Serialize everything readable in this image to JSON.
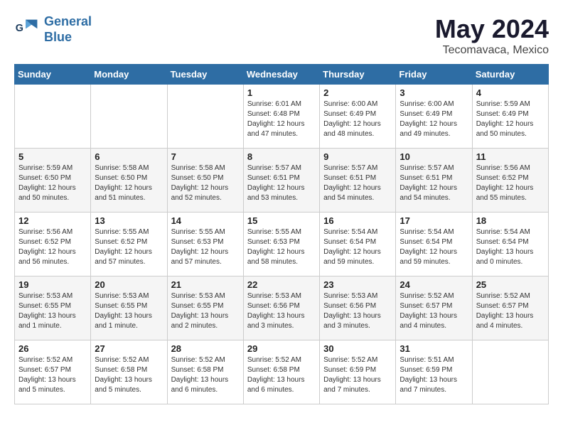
{
  "logo": {
    "line1": "General",
    "line2": "Blue"
  },
  "title": "May 2024",
  "subtitle": "Tecomavaca, Mexico",
  "days_of_week": [
    "Sunday",
    "Monday",
    "Tuesday",
    "Wednesday",
    "Thursday",
    "Friday",
    "Saturday"
  ],
  "weeks": [
    [
      {
        "day": "",
        "info": ""
      },
      {
        "day": "",
        "info": ""
      },
      {
        "day": "",
        "info": ""
      },
      {
        "day": "1",
        "info": "Sunrise: 6:01 AM\nSunset: 6:48 PM\nDaylight: 12 hours\nand 47 minutes."
      },
      {
        "day": "2",
        "info": "Sunrise: 6:00 AM\nSunset: 6:49 PM\nDaylight: 12 hours\nand 48 minutes."
      },
      {
        "day": "3",
        "info": "Sunrise: 6:00 AM\nSunset: 6:49 PM\nDaylight: 12 hours\nand 49 minutes."
      },
      {
        "day": "4",
        "info": "Sunrise: 5:59 AM\nSunset: 6:49 PM\nDaylight: 12 hours\nand 50 minutes."
      }
    ],
    [
      {
        "day": "5",
        "info": "Sunrise: 5:59 AM\nSunset: 6:50 PM\nDaylight: 12 hours\nand 50 minutes."
      },
      {
        "day": "6",
        "info": "Sunrise: 5:58 AM\nSunset: 6:50 PM\nDaylight: 12 hours\nand 51 minutes."
      },
      {
        "day": "7",
        "info": "Sunrise: 5:58 AM\nSunset: 6:50 PM\nDaylight: 12 hours\nand 52 minutes."
      },
      {
        "day": "8",
        "info": "Sunrise: 5:57 AM\nSunset: 6:51 PM\nDaylight: 12 hours\nand 53 minutes."
      },
      {
        "day": "9",
        "info": "Sunrise: 5:57 AM\nSunset: 6:51 PM\nDaylight: 12 hours\nand 54 minutes."
      },
      {
        "day": "10",
        "info": "Sunrise: 5:57 AM\nSunset: 6:51 PM\nDaylight: 12 hours\nand 54 minutes."
      },
      {
        "day": "11",
        "info": "Sunrise: 5:56 AM\nSunset: 6:52 PM\nDaylight: 12 hours\nand 55 minutes."
      }
    ],
    [
      {
        "day": "12",
        "info": "Sunrise: 5:56 AM\nSunset: 6:52 PM\nDaylight: 12 hours\nand 56 minutes."
      },
      {
        "day": "13",
        "info": "Sunrise: 5:55 AM\nSunset: 6:52 PM\nDaylight: 12 hours\nand 57 minutes."
      },
      {
        "day": "14",
        "info": "Sunrise: 5:55 AM\nSunset: 6:53 PM\nDaylight: 12 hours\nand 57 minutes."
      },
      {
        "day": "15",
        "info": "Sunrise: 5:55 AM\nSunset: 6:53 PM\nDaylight: 12 hours\nand 58 minutes."
      },
      {
        "day": "16",
        "info": "Sunrise: 5:54 AM\nSunset: 6:54 PM\nDaylight: 12 hours\nand 59 minutes."
      },
      {
        "day": "17",
        "info": "Sunrise: 5:54 AM\nSunset: 6:54 PM\nDaylight: 12 hours\nand 59 minutes."
      },
      {
        "day": "18",
        "info": "Sunrise: 5:54 AM\nSunset: 6:54 PM\nDaylight: 13 hours\nand 0 minutes."
      }
    ],
    [
      {
        "day": "19",
        "info": "Sunrise: 5:53 AM\nSunset: 6:55 PM\nDaylight: 13 hours\nand 1 minute."
      },
      {
        "day": "20",
        "info": "Sunrise: 5:53 AM\nSunset: 6:55 PM\nDaylight: 13 hours\nand 1 minute."
      },
      {
        "day": "21",
        "info": "Sunrise: 5:53 AM\nSunset: 6:55 PM\nDaylight: 13 hours\nand 2 minutes."
      },
      {
        "day": "22",
        "info": "Sunrise: 5:53 AM\nSunset: 6:56 PM\nDaylight: 13 hours\nand 3 minutes."
      },
      {
        "day": "23",
        "info": "Sunrise: 5:53 AM\nSunset: 6:56 PM\nDaylight: 13 hours\nand 3 minutes."
      },
      {
        "day": "24",
        "info": "Sunrise: 5:52 AM\nSunset: 6:57 PM\nDaylight: 13 hours\nand 4 minutes."
      },
      {
        "day": "25",
        "info": "Sunrise: 5:52 AM\nSunset: 6:57 PM\nDaylight: 13 hours\nand 4 minutes."
      }
    ],
    [
      {
        "day": "26",
        "info": "Sunrise: 5:52 AM\nSunset: 6:57 PM\nDaylight: 13 hours\nand 5 minutes."
      },
      {
        "day": "27",
        "info": "Sunrise: 5:52 AM\nSunset: 6:58 PM\nDaylight: 13 hours\nand 5 minutes."
      },
      {
        "day": "28",
        "info": "Sunrise: 5:52 AM\nSunset: 6:58 PM\nDaylight: 13 hours\nand 6 minutes."
      },
      {
        "day": "29",
        "info": "Sunrise: 5:52 AM\nSunset: 6:58 PM\nDaylight: 13 hours\nand 6 minutes."
      },
      {
        "day": "30",
        "info": "Sunrise: 5:52 AM\nSunset: 6:59 PM\nDaylight: 13 hours\nand 7 minutes."
      },
      {
        "day": "31",
        "info": "Sunrise: 5:51 AM\nSunset: 6:59 PM\nDaylight: 13 hours\nand 7 minutes."
      },
      {
        "day": "",
        "info": ""
      }
    ]
  ]
}
